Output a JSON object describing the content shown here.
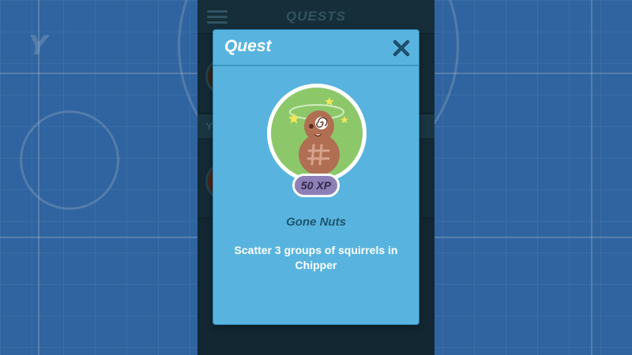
{
  "app": {
    "screen_title": "QUESTS",
    "background_letter": "Y",
    "section_marker": "Y"
  },
  "modal": {
    "title": "Quest",
    "close_icon": "close-icon",
    "badge_icon": "dizzy-peanut-icon",
    "xp_label": "50 XP",
    "quest_name": "Gone Nuts",
    "description": "Scatter 3 groups of squirrels in Chipper"
  },
  "colors": {
    "modal_bg": "#58b4df",
    "badge_ring": "#8cc86a",
    "xp_pill": "#8e7fb6",
    "peanut": "#b06f53"
  }
}
